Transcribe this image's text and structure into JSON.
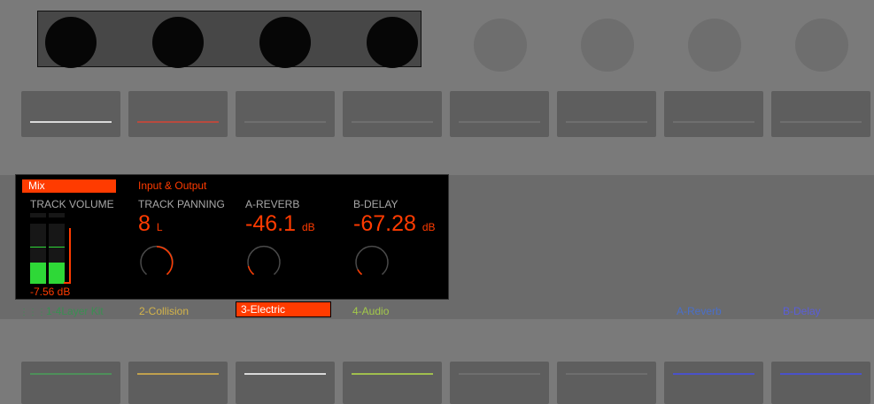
{
  "colors": {
    "accent": "#ff3b00",
    "meter": "#2ed837"
  },
  "mix_display": {
    "tab": "Mix",
    "section": "Input & Output",
    "params": [
      {
        "name": "TRACK VOLUME",
        "value": "",
        "unit": ""
      },
      {
        "name": "TRACK PANNING",
        "value": "8",
        "unit": "L"
      },
      {
        "name": "A-REVERB",
        "value": "-46.1",
        "unit": "dB"
      },
      {
        "name": "B-DELAY",
        "value": "-67.28",
        "unit": "dB"
      }
    ],
    "volume_readout": "-7.56 dB"
  },
  "tracks": [
    {
      "label": "1-4Layer Kit",
      "color": "#3a8f52",
      "icon": "grid-icon"
    },
    {
      "label": "2-Collision",
      "color": "#d4b44a"
    },
    {
      "label": "3-Electric",
      "color": "#ffffff",
      "selected": true
    },
    {
      "label": "4-Audio",
      "color": "#a3c94a"
    },
    {
      "label": "A-Reverb",
      "color": "#4a6fc9"
    },
    {
      "label": "B-Delay",
      "color": "#5a5ed9"
    }
  ],
  "top_button_colors": [
    "#d9d9d9",
    "#b84a3e",
    "#6e6e6e",
    "#6e6e6e",
    "#6e6e6e",
    "#6e6e6e",
    "#6e6e6e",
    "#6e6e6e"
  ],
  "bottom_button_colors": [
    "#4e8f5a",
    "#c0a04e",
    "#d9d9d9",
    "#a0bf4e",
    "#6e6e6e",
    "#6e6e6e",
    "#4a52c9",
    "#4a52c9"
  ]
}
